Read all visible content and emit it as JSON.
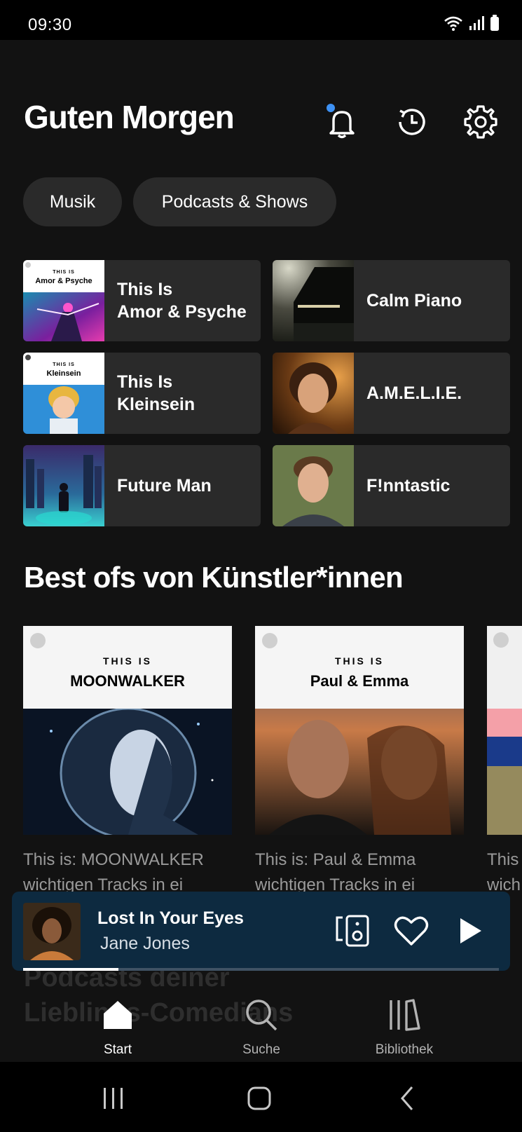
{
  "status_bar": {
    "time": "09:30",
    "icons": [
      "wifi-icon",
      "signal-icon",
      "battery-icon"
    ]
  },
  "header": {
    "title": "Guten Morgen",
    "icons": [
      "bell-icon",
      "history-icon",
      "gear-icon"
    ],
    "notification_dot_color": "#3d91f4"
  },
  "filters": [
    {
      "label": "Musik"
    },
    {
      "label": "Podcasts & Shows"
    }
  ],
  "shortcuts": [
    {
      "label": "This Is\nAmor & Psyche",
      "art_kicker": "THIS IS",
      "art_name": "Amor & Psyche"
    },
    {
      "label": "Calm Piano"
    },
    {
      "label": "This Is\nKleinsein",
      "art_kicker": "THIS IS",
      "art_name": "Kleinsein"
    },
    {
      "label": "A.M.E.L.I.E."
    },
    {
      "label": "Future Man"
    },
    {
      "label": "F!nntastic"
    }
  ],
  "section": {
    "title": "Best ofs von Künstler*innen",
    "cards": [
      {
        "kicker": "THIS IS",
        "name": "MOONWALKER",
        "desc_line1": "This is: MOONWALKER",
        "desc_line2": "wichtigen Tracks in ei"
      },
      {
        "kicker": "THIS IS",
        "name": "Paul & Emma",
        "desc_line1": "This is: Paul & Emma",
        "desc_line2": "wichtigen Tracks in ei"
      },
      {
        "desc_line1": "This",
        "desc_line2": "wich"
      }
    ]
  },
  "next_section": {
    "title": "Podcasts deiner\nLieblings-Comedians"
  },
  "now_playing": {
    "title": "Lost In Your Eyes",
    "artist": "Jane Jones",
    "progress": 0.2,
    "background_color": "#0d2a40",
    "icons": [
      "device-speaker-icon",
      "heart-icon",
      "play-icon"
    ]
  },
  "bottom_nav": [
    {
      "label": "Start",
      "icon": "home-icon",
      "active": true
    },
    {
      "label": "Suche",
      "icon": "search-icon",
      "active": false
    },
    {
      "label": "Bibliothek",
      "icon": "library-icon",
      "active": false
    }
  ],
  "system_nav": [
    "recent-apps-icon",
    "home-button-icon",
    "back-icon"
  ]
}
